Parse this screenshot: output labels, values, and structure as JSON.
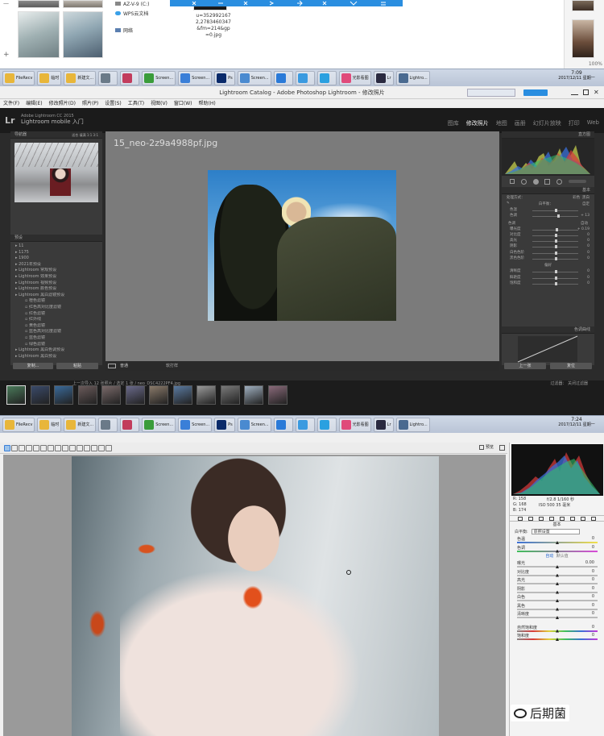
{
  "explorer": {
    "drives": [
      "AZ-V-9 (C:)",
      "WPS云文档",
      "网络"
    ],
    "cell_text": "u=3529921672,2783460347&fm=214&gp=0.jpg",
    "zoom_text": "100%",
    "side_minus": "—",
    "side_plus": "+"
  },
  "taskbar1": {
    "items": [
      "FileRecv",
      "临时",
      "新建文...",
      "",
      "",
      "Screen...",
      "Screen...",
      "Ps",
      "Screen...",
      "",
      "",
      "",
      "光影看图",
      "Lr",
      "Lightro..."
    ],
    "time": "7:09",
    "date": "2017/12/11 星期一"
  },
  "lightroom": {
    "title": "Lightroom Catalog - Adobe Photoshop Lightroom - 修改照片",
    "menu": [
      "文件(F)",
      "编辑(E)",
      "修改照片(D)",
      "照片(P)",
      "设置(S)",
      "工具(T)",
      "视图(V)",
      "窗口(W)",
      "帮助(H)"
    ],
    "logo": "Lr",
    "logo_sub1": "Adobe Lightroom CC 2015",
    "logo_sub2": "Lightroom mobile 入门",
    "modules": [
      "图库",
      "修改照片",
      "地图",
      "画册",
      "幻灯片放映",
      "打印",
      "Web"
    ],
    "active_module": "修改照片",
    "navigator_label": "导航器",
    "navigator_opts": "适合  填满  1:1  3:1",
    "presets_label": "预设",
    "presets": [
      "11",
      "1175",
      "1900",
      "2021年预设",
      "Lightroom 常规预设",
      "Lightroom 效果预设",
      "Lightroom 视频预设",
      "Lightroom 颜色预设",
      "Lightroom 黑白滤镜预设",
      "橙色滤镜",
      "红色高对比度滤镜",
      "红色滤镜",
      "红外线",
      "黄色滤镜",
      "蓝色高对比度滤镜",
      "蓝色滤镜",
      "绿色滤镜",
      "Lightroom 黑白色调预设",
      "Lightroom 黑白预设"
    ],
    "copy_btn": "复制...",
    "paste_btn": "粘贴",
    "filename": "15_neo-2z9a4988pf.jpg",
    "histogram_label": "直方图",
    "basic_label": "基本",
    "treatment_label": "处理方式：",
    "treatment_color": "彩色",
    "treatment_bw": "黑白",
    "wb_label": "白平衡：",
    "wb_value": "自定",
    "tone_label": "色调",
    "auto_label": "自动",
    "presence_label": "偏好",
    "sliders": [
      {
        "label": "色温",
        "value": "",
        "pos": 0.5
      },
      {
        "label": "色调",
        "value": "+ 13",
        "pos": 0.56
      },
      {
        "label": "曝光度",
        "value": "+ 0.19",
        "pos": 0.53
      },
      {
        "label": "对比度",
        "value": "0",
        "pos": 0.5
      },
      {
        "label": "高光",
        "value": "0",
        "pos": 0.5
      },
      {
        "label": "阴影",
        "value": "0",
        "pos": 0.5
      },
      {
        "label": "白色色阶",
        "value": "0",
        "pos": 0.5
      },
      {
        "label": "黑色色阶",
        "value": "0",
        "pos": 0.5
      },
      {
        "label": "清晰度",
        "value": "0",
        "pos": 0.5
      },
      {
        "label": "鲜艳度",
        "value": "0",
        "pos": 0.5
      },
      {
        "label": "饱和度",
        "value": "0",
        "pos": 0.5
      }
    ],
    "tone_curve_label": "色调曲线",
    "prev_btn": "上一张",
    "reset_btn": "复位",
    "view_label": "普通",
    "softproof_label": "软打样",
    "film_info": "上一次导入  12 张照片 / 选定 1 张 / neo_DSC4222PF4.jpg",
    "filter_label": "过滤器：",
    "filter_value": "关闭过滤器"
  },
  "taskbar2": {
    "items": [
      "FileRecv",
      "临时",
      "新建文...",
      "",
      "",
      "Screen...",
      "Screen...",
      "Ps",
      "Screen...",
      "",
      "",
      "",
      "光影看图",
      "Lr",
      "Lightro..."
    ],
    "time": "7:24",
    "date": "2017/12/11 星期一"
  },
  "camera_raw": {
    "preview_label": "预览",
    "readout_r": "R: 158",
    "readout_g": "G: 168",
    "readout_b": "B: 174",
    "readout_exp": "f/2.8  1/160 秒",
    "readout_iso": "ISO 500  35 毫米",
    "basic_label": "基本",
    "wb_label": "白平衡:",
    "wb_value": "原照设置",
    "auto_link": "自动",
    "default_link": "默认值",
    "sliders": [
      {
        "label": "色温",
        "value": "0",
        "pos": 0.5,
        "track": "temp"
      },
      {
        "label": "色调",
        "value": "0",
        "pos": 0.5,
        "track": "tint"
      },
      {
        "label": "曝光",
        "value": "0.00",
        "pos": 0.5,
        "track": "gray"
      },
      {
        "label": "对比度",
        "value": "0",
        "pos": 0.5,
        "track": "gray"
      },
      {
        "label": "高光",
        "value": "0",
        "pos": 0.5,
        "track": "gray"
      },
      {
        "label": "阴影",
        "value": "0",
        "pos": 0.5,
        "track": "gray"
      },
      {
        "label": "白色",
        "value": "0",
        "pos": 0.5,
        "track": "gray"
      },
      {
        "label": "黑色",
        "value": "0",
        "pos": 0.5,
        "track": "gray"
      },
      {
        "label": "清晰度",
        "value": "0",
        "pos": 0.5,
        "track": "gray"
      },
      {
        "label": "自然饱和度",
        "value": "0",
        "pos": 0.5,
        "track": "sat"
      },
      {
        "label": "饱和度",
        "value": "0",
        "pos": 0.5,
        "track": "sat"
      }
    ]
  },
  "watermark": "后期菌",
  "colors": {
    "lr_dark": "#2b2b2b",
    "taskbar": "#c4cede",
    "accent": "#2a8ee0"
  }
}
